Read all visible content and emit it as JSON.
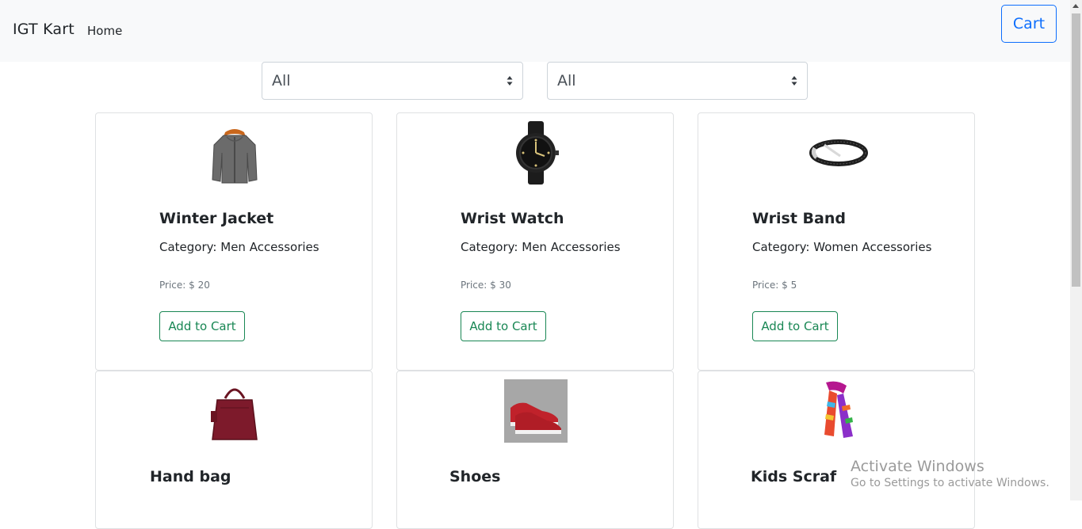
{
  "navbar": {
    "brand": "IGT Kart",
    "home": "Home",
    "cart": "Cart"
  },
  "filters": {
    "select1": "All",
    "select2": "All"
  },
  "products": [
    {
      "name": "Winter Jacket",
      "category": "Category: Men Accessories",
      "price": "Price: $ 20",
      "button": "Add to Cart",
      "icon": "jacket-icon"
    },
    {
      "name": "Wrist Watch",
      "category": "Category: Men Accessories",
      "price": "Price: $ 30",
      "button": "Add to Cart",
      "icon": "watch-icon"
    },
    {
      "name": "Wrist Band",
      "category": "Category: Women Accessories",
      "price": "Price: $ 5",
      "button": "Add to Cart",
      "icon": "bracelet-icon"
    },
    {
      "name": "Hand bag",
      "icon": "handbag-icon"
    },
    {
      "name": "Shoes",
      "icon": "shoes-icon"
    },
    {
      "name": "Kids Scraf",
      "icon": "scarf-icon"
    }
  ],
  "watermark": {
    "title": "Activate Windows",
    "subtitle": "Go to Settings to activate Windows."
  },
  "colors": {
    "primary": "#0d6efd",
    "success": "#198754",
    "navbar_bg": "#f8f9fa"
  }
}
